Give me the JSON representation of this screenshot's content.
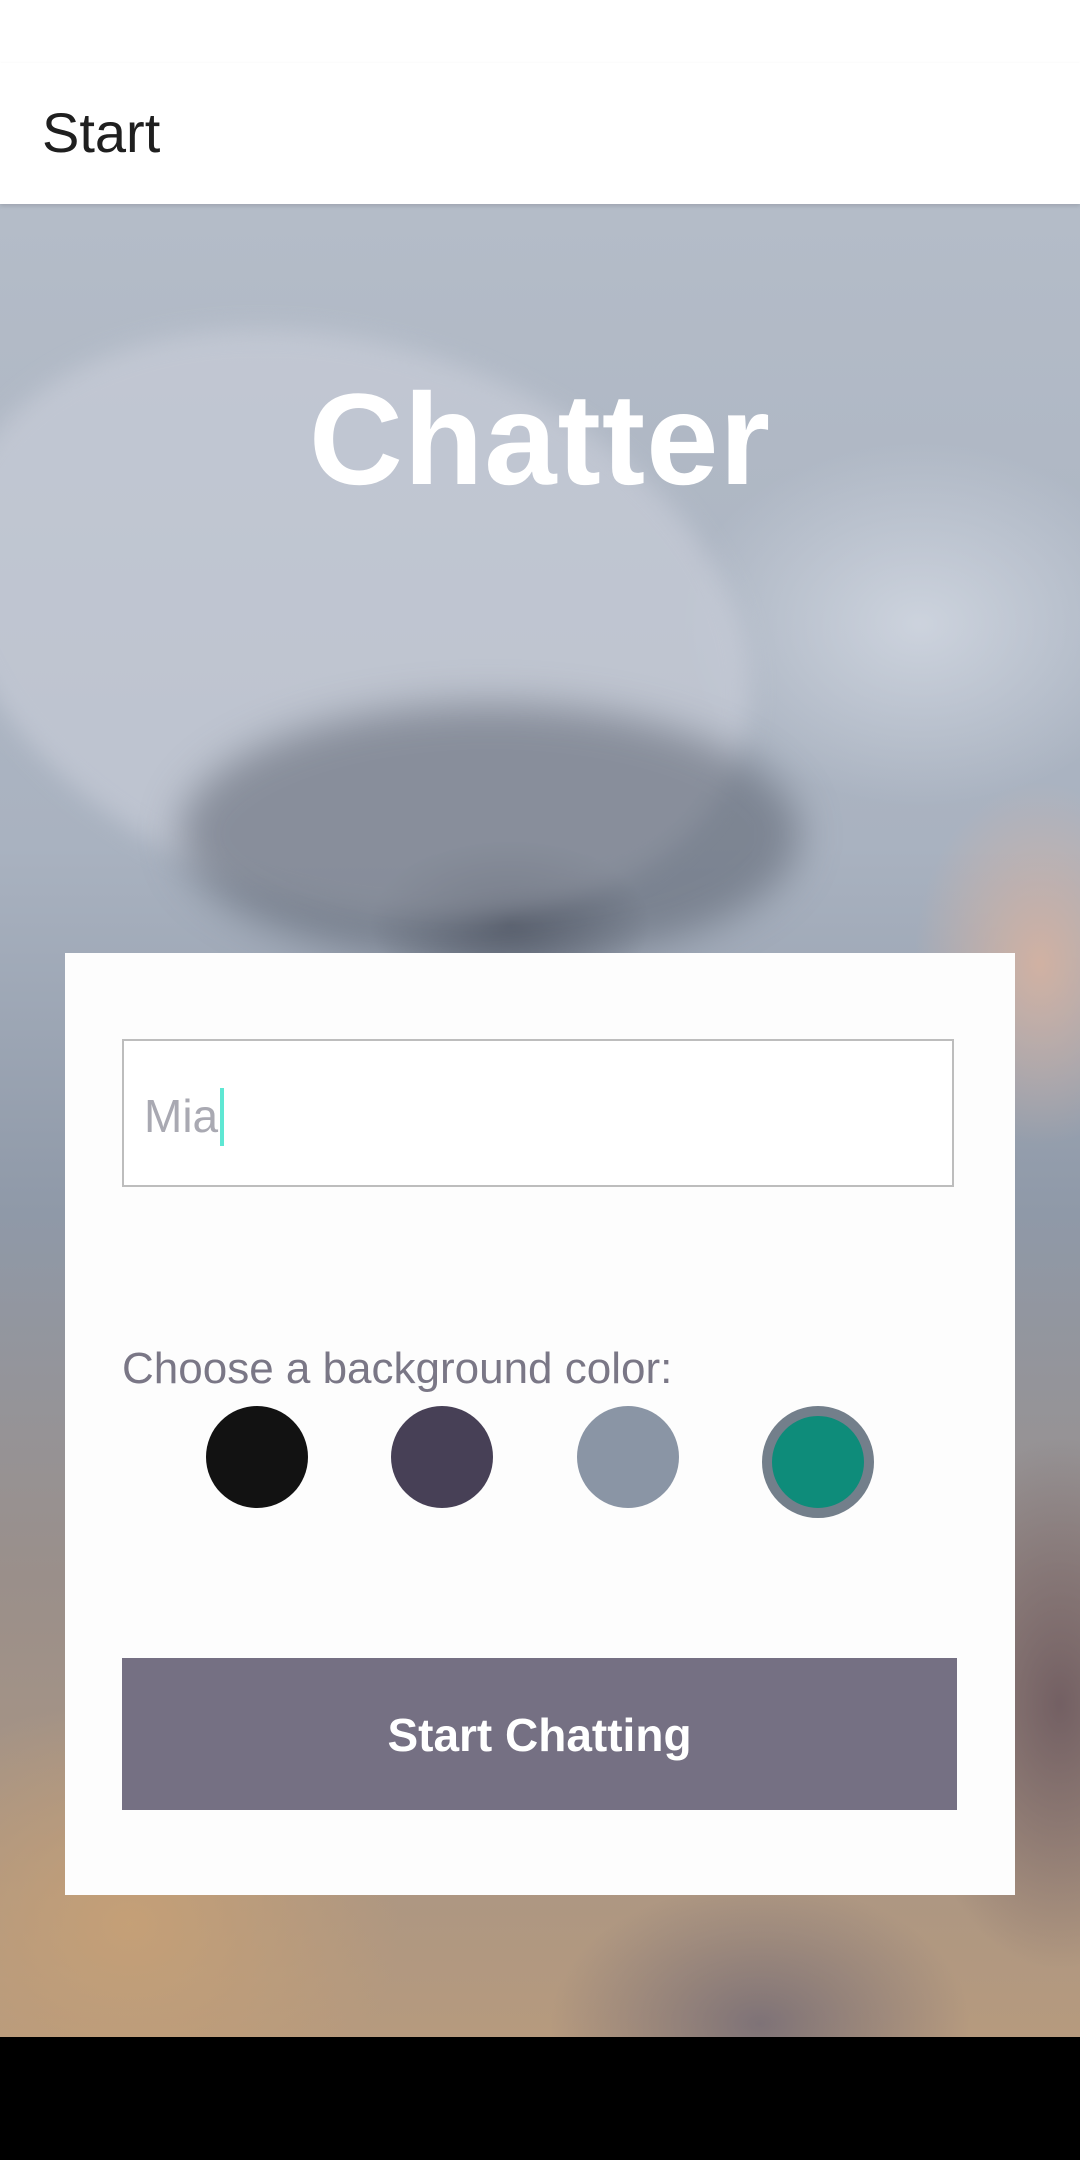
{
  "app_bar": {
    "title": "Start"
  },
  "hero": {
    "app_title": "Chatter"
  },
  "form": {
    "name_input": {
      "value": "Mia"
    },
    "color_label": "Choose a background color:",
    "colors": [
      {
        "name": "black",
        "hex": "#121212",
        "selected": false
      },
      {
        "name": "purple",
        "hex": "#474056",
        "selected": false
      },
      {
        "name": "grey-blue",
        "hex": "#8a95a5",
        "selected": false
      },
      {
        "name": "teal",
        "hex": "#0e8c7a",
        "selected": true
      }
    ],
    "start_button": "Start Chatting"
  },
  "theme": {
    "button_color": "#757083",
    "caret_color": "#5ee7d3",
    "selected_ring_color": "#737f8b"
  }
}
